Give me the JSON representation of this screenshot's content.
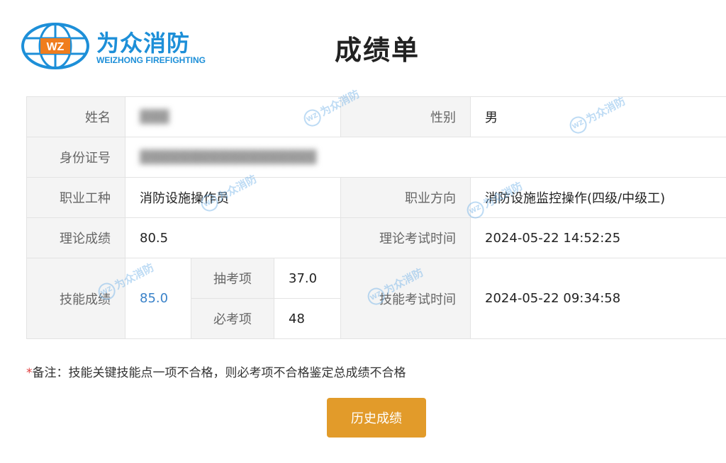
{
  "logo": {
    "name_cn": "为众消防",
    "name_en": "WEIZHONG FIREFIGHTING",
    "mark": "WZ"
  },
  "title": "成绩单",
  "watermark_text": "为众消防",
  "rows": {
    "name_label": "姓名",
    "name_value": "▓▓▓",
    "gender_label": "性别",
    "gender_value": "男",
    "id_label": "身份证号",
    "id_value": "▓▓▓▓▓▓▓▓▓▓▓▓▓▓▓▓▓▓",
    "occupation_label": "职业工种",
    "occupation_value": "消防设施操作员",
    "direction_label": "职业方向",
    "direction_value": "消防设施监控操作(四级/中级工)",
    "theory_label": "理论成绩",
    "theory_value": "80.5",
    "theory_time_label": "理论考试时间",
    "theory_time_value": "2024-05-22 14:52:25",
    "skill_label": "技能成绩",
    "skill_value": "85.0",
    "random_label": "抽考项",
    "random_value": "37.0",
    "required_label": "必考项",
    "required_value": "48",
    "skill_time_label": "技能考试时间",
    "skill_time_value": "2024-05-22 09:34:58"
  },
  "note": {
    "star": "*",
    "text": "备注：技能关键技能点一项不合格，则必考项不合格鉴定总成绩不合格"
  },
  "history_button": "历史成绩",
  "colors": {
    "brand_blue": "#1d8fd8",
    "button_orange": "#e29b2a",
    "skill_blue": "#3a82c9"
  }
}
